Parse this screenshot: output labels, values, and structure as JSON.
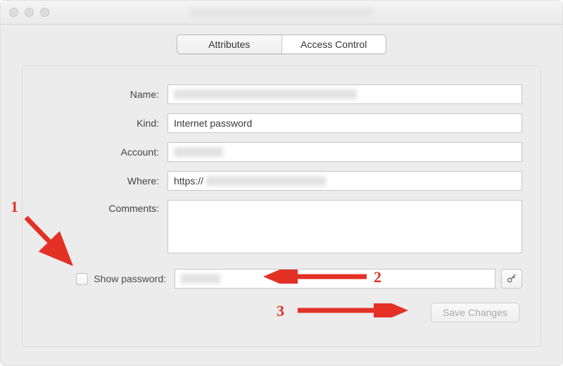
{
  "window": {
    "title_redacted": true
  },
  "tabs": [
    {
      "label": "Attributes",
      "active": true
    },
    {
      "label": "Access Control",
      "active": false
    }
  ],
  "fields": {
    "name": {
      "label": "Name:",
      "value_redacted": true
    },
    "kind": {
      "label": "Kind:",
      "value": "Internet password"
    },
    "account": {
      "label": "Account:",
      "value_redacted": true
    },
    "where": {
      "label": "Where:",
      "prefix": "https://",
      "value_redacted": true
    },
    "comments": {
      "label": "Comments:",
      "value": ""
    }
  },
  "show_password": {
    "label": "Show password:",
    "checked": false,
    "value_redacted": true
  },
  "icons": {
    "key": "key-icon",
    "item": "globe-icon"
  },
  "buttons": {
    "save_changes": "Save Changes"
  },
  "annotations": {
    "labels": [
      "1",
      "2",
      "3"
    ],
    "color": "#e33126"
  }
}
